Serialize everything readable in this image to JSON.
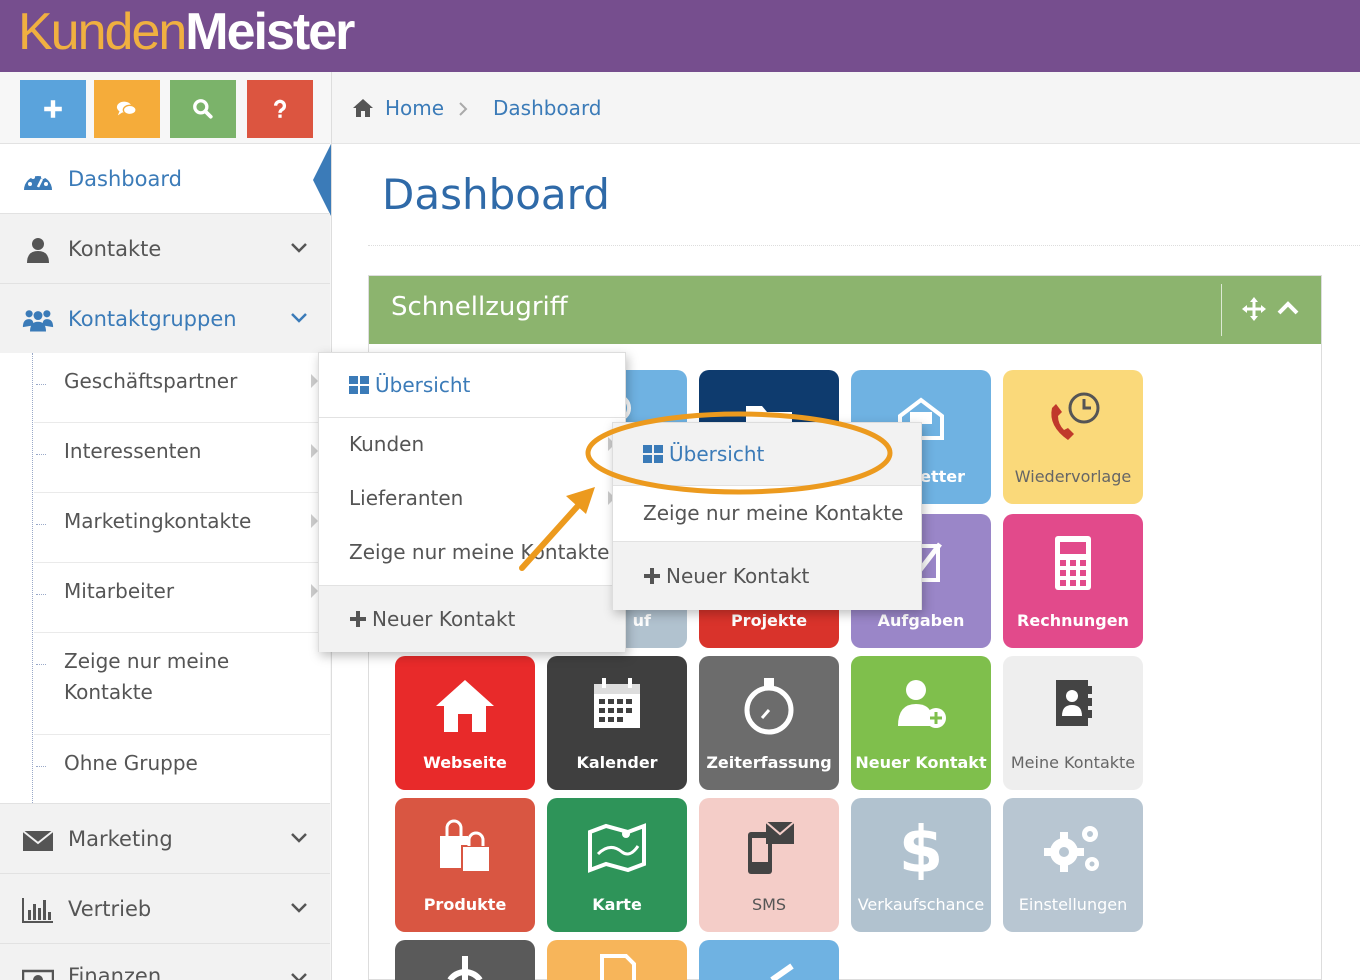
{
  "app": {
    "logo_part1": "Kunden",
    "logo_part2": "Meister"
  },
  "shortcuts": [
    {
      "name": "add",
      "icon": "plus-icon",
      "color": "#5aa3dc"
    },
    {
      "name": "chat",
      "icon": "chat-icon",
      "color": "#f5ac3a"
    },
    {
      "name": "search",
      "icon": "search-icon",
      "color": "#7bb36a"
    },
    {
      "name": "help",
      "icon": "question-icon",
      "color": "#dc5540"
    }
  ],
  "sidebar": {
    "items": [
      {
        "label": "Dashboard",
        "icon": "dashboard-icon",
        "active": true
      },
      {
        "label": "Kontakte",
        "icon": "user-icon"
      },
      {
        "label": "Kontaktgruppen",
        "icon": "users-icon"
      }
    ],
    "sub_items": [
      {
        "label": "Geschäftspartner"
      },
      {
        "label": "Interessenten"
      },
      {
        "label": "Marketingkontakte"
      },
      {
        "label": "Mitarbeiter"
      },
      {
        "label_line1": "Zeige nur meine",
        "label_line2": "Kontakte"
      },
      {
        "label": "Ohne Gruppe"
      }
    ],
    "items_bottom": [
      {
        "label": "Marketing",
        "icon": "envelope-icon"
      },
      {
        "label": "Vertrieb",
        "icon": "bar-chart-icon"
      },
      {
        "label": "Finanzen",
        "icon": "money-icon"
      }
    ]
  },
  "breadcrumb": {
    "home": "Home",
    "current": "Dashboard"
  },
  "page_title": "Dashboard",
  "widget": {
    "title": "Schnellzugriff"
  },
  "tiles": [
    {
      "label": "Wiedervorlage",
      "color": "#fad97a",
      "icon": "phone-clock-icon"
    },
    {
      "label": "Projekte",
      "color": "#d9332b",
      "icon": "folder-icon"
    },
    {
      "label": "Aufgaben",
      "color": "#9a86c8",
      "icon": "checkbox-icon"
    },
    {
      "label": "Rechnungen",
      "color": "#e24a8b",
      "icon": "calculator-icon"
    },
    {
      "label": "Webseite",
      "color": "#e82a2a",
      "icon": "home-icon"
    },
    {
      "label": "Kalender",
      "color": "#3f3f3f",
      "icon": "calendar-icon"
    },
    {
      "label": "Zeiterfassung",
      "color": "#6c6c6c",
      "icon": "stopwatch-icon"
    },
    {
      "label": "Neuer Kontakt",
      "color": "#7fbf4c",
      "icon": "add-user-icon"
    },
    {
      "label": "Meine Kontakte",
      "color": "#eeeeee",
      "icon": "address-book-icon"
    },
    {
      "label": "Produkte",
      "color": "#d95642",
      "icon": "shopping-bags-icon"
    },
    {
      "label": "Karte",
      "color": "#2e9459",
      "icon": "map-icon"
    },
    {
      "label": "SMS",
      "color": "#f4cdc8",
      "icon": "sms-icon"
    },
    {
      "label": "Verkaufschance",
      "color": "#b1c2cf",
      "icon": "dollar-icon"
    },
    {
      "label": "Einstellungen",
      "color": "#b8c6d2",
      "icon": "gears-icon"
    },
    {
      "label": "",
      "color": "#5a5a5a",
      "icon": "power-icon"
    },
    {
      "label": "",
      "color": "#f7b55a",
      "icon": "document-icon"
    },
    {
      "label": "",
      "color": "#6fb2e2",
      "icon": "check-icon"
    }
  ],
  "partial_tiles": {
    "newsletter_partial": "letter",
    "verkauf_partial": "uf"
  },
  "menu1": {
    "header": "Übersicht",
    "items": [
      "Kunden",
      "Lieferanten",
      "Zeige nur meine Kontakte"
    ],
    "new": "Neuer Kontakt"
  },
  "menu2": {
    "header": "Übersicht",
    "items": [
      "Zeige nur meine Kontakte"
    ],
    "new": "Neuer Kontakt"
  },
  "colors": {
    "header": "#764e8e",
    "accent": "#3b7bb8",
    "widget_head": "#8cb46e",
    "highlight": "#ec9a1e"
  }
}
